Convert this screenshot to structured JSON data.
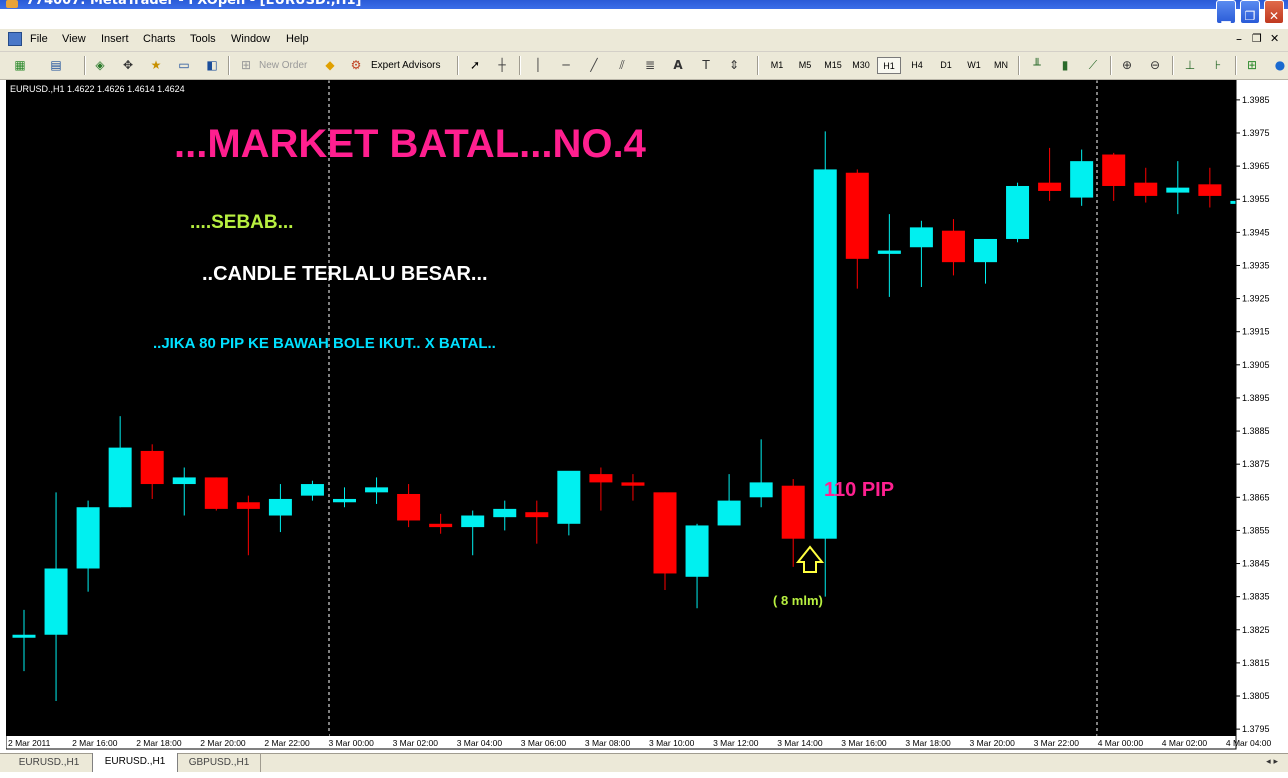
{
  "window": {
    "title": "774007: MetaTrader - FXOpen - [EURUSD.,H1]"
  },
  "menu": [
    "File",
    "View",
    "Insert",
    "Charts",
    "Tools",
    "Window",
    "Help"
  ],
  "toolbar": {
    "new_order": "New Order",
    "expert_advisors": "Expert Advisors",
    "timeframes": [
      "M1",
      "M5",
      "M15",
      "M30",
      "H1",
      "H4",
      "D1",
      "W1",
      "MN"
    ],
    "active_timeframe": "H1"
  },
  "chart": {
    "info": "EURUSD.,H1  1.4622 1.4626 1.4614 1.4624",
    "annotations": {
      "headline": "...MARKET BATAL...NO.4",
      "reason": "....SEBAB...",
      "candle_note": "..CANDLE TERLALU BESAR...",
      "rule": "..JIKA 80 PIP KE BAWAH BOLE IKUT.. X BATAL..",
      "pip_label": "110 PIP",
      "time_label": "( 8 mlm)"
    },
    "colors": {
      "background": "#000000",
      "bull": "#00f0f0",
      "bear": "#ff0000",
      "headline": "#ff1f8f",
      "reason": "#b8f040",
      "candle_note": "#ffffff",
      "rule": "#00e0ff",
      "pip_label": "#ff2090",
      "time_label": "#b8f040",
      "arrow": "#ffff40"
    }
  },
  "chart_data": {
    "type": "candlestick",
    "symbol": "EURUSD.",
    "timeframe": "H1",
    "ylim": [
      1.3789,
      1.3991
    ],
    "y_ticks": [
      "1.3985",
      "1.3975",
      "1.3965",
      "1.3955",
      "1.3945",
      "1.3935",
      "1.3925",
      "1.3915",
      "1.3905",
      "1.3895",
      "1.3885",
      "1.3875",
      "1.3865",
      "1.3855",
      "1.3845",
      "1.3835",
      "1.3825",
      "1.3815",
      "1.3805",
      "1.3795"
    ],
    "x_ticks": [
      "2 Mar 2011",
      "2 Mar 16:00",
      "2 Mar 18:00",
      "2 Mar 20:00",
      "2 Mar 22:00",
      "3 Mar 00:00",
      "3 Mar 02:00",
      "3 Mar 04:00",
      "3 Mar 06:00",
      "3 Mar 08:00",
      "3 Mar 10:00",
      "3 Mar 12:00",
      "3 Mar 14:00",
      "3 Mar 16:00",
      "3 Mar 18:00",
      "3 Mar 20:00",
      "3 Mar 22:00",
      "4 Mar 00:00",
      "4 Mar 02:00",
      "4 Mar 04:00"
    ],
    "candles": [
      {
        "o": 1.38235,
        "h": 1.3831,
        "l": 1.38125,
        "c": 1.38235
      },
      {
        "o": 1.38235,
        "h": 1.38665,
        "l": 1.38035,
        "c": 1.38435
      },
      {
        "o": 1.38435,
        "h": 1.3864,
        "l": 1.38365,
        "c": 1.3862
      },
      {
        "o": 1.3862,
        "h": 1.38895,
        "l": 1.3862,
        "c": 1.388
      },
      {
        "o": 1.3879,
        "h": 1.3881,
        "l": 1.38645,
        "c": 1.3869
      },
      {
        "o": 1.3869,
        "h": 1.3874,
        "l": 1.38595,
        "c": 1.3871
      },
      {
        "o": 1.3871,
        "h": 1.3871,
        "l": 1.3861,
        "c": 1.38615
      },
      {
        "o": 1.38635,
        "h": 1.38655,
        "l": 1.38475,
        "c": 1.38615
      },
      {
        "o": 1.38595,
        "h": 1.3869,
        "l": 1.38545,
        "c": 1.38645
      },
      {
        "o": 1.38655,
        "h": 1.387,
        "l": 1.3864,
        "c": 1.3869
      },
      {
        "o": 1.38635,
        "h": 1.3868,
        "l": 1.3862,
        "c": 1.38645
      },
      {
        "o": 1.38665,
        "h": 1.3871,
        "l": 1.3863,
        "c": 1.3868
      },
      {
        "o": 1.3866,
        "h": 1.3869,
        "l": 1.3856,
        "c": 1.3858
      },
      {
        "o": 1.3857,
        "h": 1.386,
        "l": 1.3854,
        "c": 1.3856
      },
      {
        "o": 1.3856,
        "h": 1.3861,
        "l": 1.38475,
        "c": 1.38595
      },
      {
        "o": 1.3859,
        "h": 1.3864,
        "l": 1.3855,
        "c": 1.38615
      },
      {
        "o": 1.38605,
        "h": 1.3864,
        "l": 1.3851,
        "c": 1.3859
      },
      {
        "o": 1.3857,
        "h": 1.38715,
        "l": 1.38535,
        "c": 1.3873
      },
      {
        "o": 1.3872,
        "h": 1.3874,
        "l": 1.3861,
        "c": 1.38695
      },
      {
        "o": 1.38695,
        "h": 1.3872,
        "l": 1.3864,
        "c": 1.38685
      },
      {
        "o": 1.38665,
        "h": 1.38665,
        "l": 1.3837,
        "c": 1.3842
      },
      {
        "o": 1.3841,
        "h": 1.3857,
        "l": 1.38315,
        "c": 1.38565
      },
      {
        "o": 1.38565,
        "h": 1.3872,
        "l": 1.38565,
        "c": 1.3864
      },
      {
        "o": 1.3865,
        "h": 1.38825,
        "l": 1.3862,
        "c": 1.38695
      },
      {
        "o": 1.38685,
        "h": 1.38705,
        "l": 1.3844,
        "c": 1.38525
      },
      {
        "o": 1.38525,
        "h": 1.39755,
        "l": 1.3835,
        "c": 1.3964
      },
      {
        "o": 1.3963,
        "h": 1.3964,
        "l": 1.3928,
        "c": 1.3937
      },
      {
        "o": 1.39385,
        "h": 1.39505,
        "l": 1.39255,
        "c": 1.39395
      },
      {
        "o": 1.39405,
        "h": 1.39485,
        "l": 1.39285,
        "c": 1.39465
      },
      {
        "o": 1.39455,
        "h": 1.3949,
        "l": 1.3932,
        "c": 1.3936
      },
      {
        "o": 1.3936,
        "h": 1.3943,
        "l": 1.39295,
        "c": 1.3943
      },
      {
        "o": 1.3943,
        "h": 1.396,
        "l": 1.3942,
        "c": 1.3959
      },
      {
        "o": 1.396,
        "h": 1.39705,
        "l": 1.39545,
        "c": 1.39575
      },
      {
        "o": 1.39555,
        "h": 1.397,
        "l": 1.3953,
        "c": 1.39665
      },
      {
        "o": 1.39685,
        "h": 1.3969,
        "l": 1.39545,
        "c": 1.3959
      },
      {
        "o": 1.396,
        "h": 1.39645,
        "l": 1.3954,
        "c": 1.3956
      },
      {
        "o": 1.3957,
        "h": 1.39665,
        "l": 1.39505,
        "c": 1.39585
      },
      {
        "o": 1.39595,
        "h": 1.39645,
        "l": 1.39525,
        "c": 1.3956
      },
      {
        "o": 1.39545,
        "h": 1.3958,
        "l": 1.395,
        "c": 1.39545
      }
    ]
  },
  "tabs": [
    "EURUSD.,H1",
    "EURUSD.,H1",
    "GBPUSD.,H1"
  ],
  "active_tab": 1
}
